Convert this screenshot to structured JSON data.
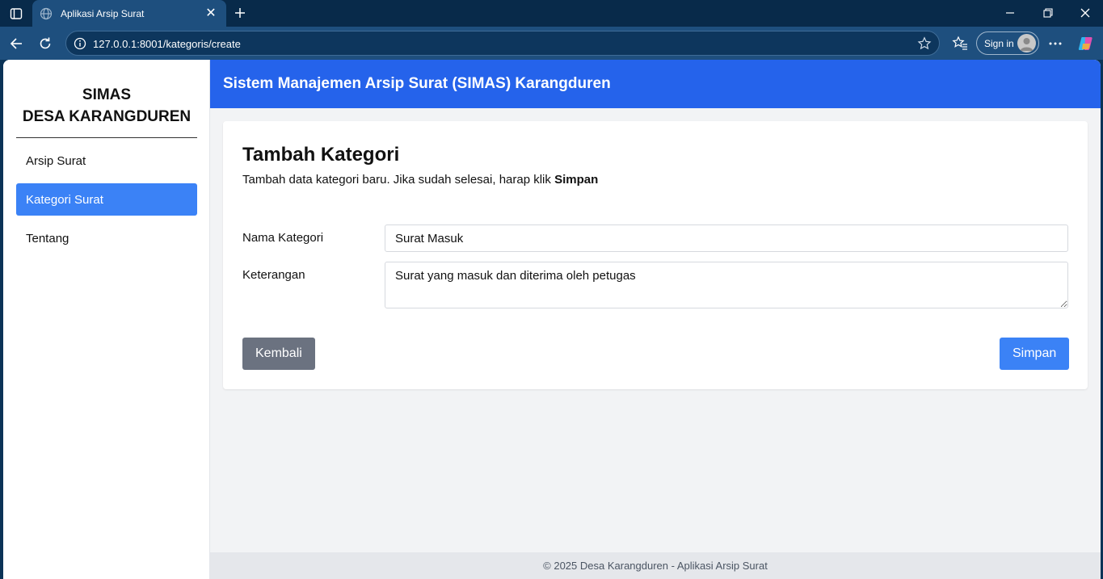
{
  "browser": {
    "tab_title": "Aplikasi Arsip Surat",
    "url": "127.0.0.1:8001/kategoris/create",
    "signin_label": "Sign in"
  },
  "sidebar": {
    "brand_line1": "SIMAS",
    "brand_line2": "DESA KARANGDUREN",
    "items": [
      {
        "label": "Arsip Surat",
        "active": false
      },
      {
        "label": "Kategori Surat",
        "active": true
      },
      {
        "label": "Tentang",
        "active": false
      }
    ]
  },
  "header": {
    "title": "Sistem Manajemen Arsip Surat (SIMAS) Karangduren"
  },
  "form": {
    "title": "Tambah Kategori",
    "subtitle_prefix": "Tambah data kategori baru. Jika sudah selesai, harap klik ",
    "subtitle_bold": "Simpan",
    "name_label": "Nama Kategori",
    "name_value": "Surat Masuk",
    "desc_label": "Keterangan",
    "desc_value": "Surat yang masuk dan diterima oleh petugas",
    "back_label": "Kembali",
    "save_label": "Simpan"
  },
  "footer": {
    "text": "© 2025 Desa Karangduren - Aplikasi Arsip Surat"
  },
  "colors": {
    "header_bg": "#2563eb",
    "active_menu": "#3b82f6",
    "save_button": "#3b82f6",
    "back_button": "#6b7280"
  }
}
